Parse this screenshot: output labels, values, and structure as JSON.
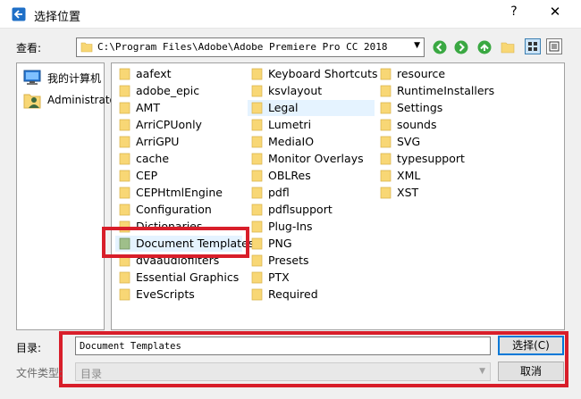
{
  "window": {
    "title": "选择位置",
    "help_label": "?",
    "close_label": "✕"
  },
  "toolbar": {
    "look_in_label": "查看:",
    "path": "C:\\Program Files\\Adobe\\Adobe Premiere Pro CC 2018",
    "combo_arrow": "▼"
  },
  "sidebar": {
    "items": [
      {
        "label": "我的计算机",
        "icon": "computer-icon"
      },
      {
        "label": "Administrator",
        "icon": "user-icon"
      }
    ]
  },
  "files": {
    "columns": [
      [
        "aafext",
        "adobe_epic",
        "AMT",
        "ArriCPUonly",
        "ArriGPU",
        "cache",
        "CEP",
        "CEPHtmlEngine",
        "Configuration",
        "Dictionaries",
        "Document Templates",
        "dvaaudiofilters",
        "Essential Graphics",
        "EveScripts"
      ],
      [
        "Keyboard Shortcuts",
        "ksvlayout",
        "Legal",
        "Lumetri",
        "MediaIO",
        "Monitor Overlays",
        "OBLRes",
        "pdfl",
        "pdflsupport",
        "Plug-Ins",
        "PNG",
        "Presets",
        "PTX",
        "Required"
      ],
      [
        "resource",
        "RuntimeInstallers",
        "Settings",
        "sounds",
        "SVG",
        "typesupport",
        "XML",
        "XST"
      ]
    ],
    "selected": "Document Templates",
    "hovered": "Legal"
  },
  "bottom": {
    "directory_label": "目录:",
    "directory_value": "Document Templates",
    "filetype_label": "文件类型:",
    "filetype_value": "目录",
    "select_button": "选择(C)",
    "cancel_button": "取消"
  },
  "colors": {
    "highlight": "#d81e2a",
    "folder": "#f8d775",
    "selection": "#e5f3ff",
    "nav_green": "#3aa842"
  }
}
